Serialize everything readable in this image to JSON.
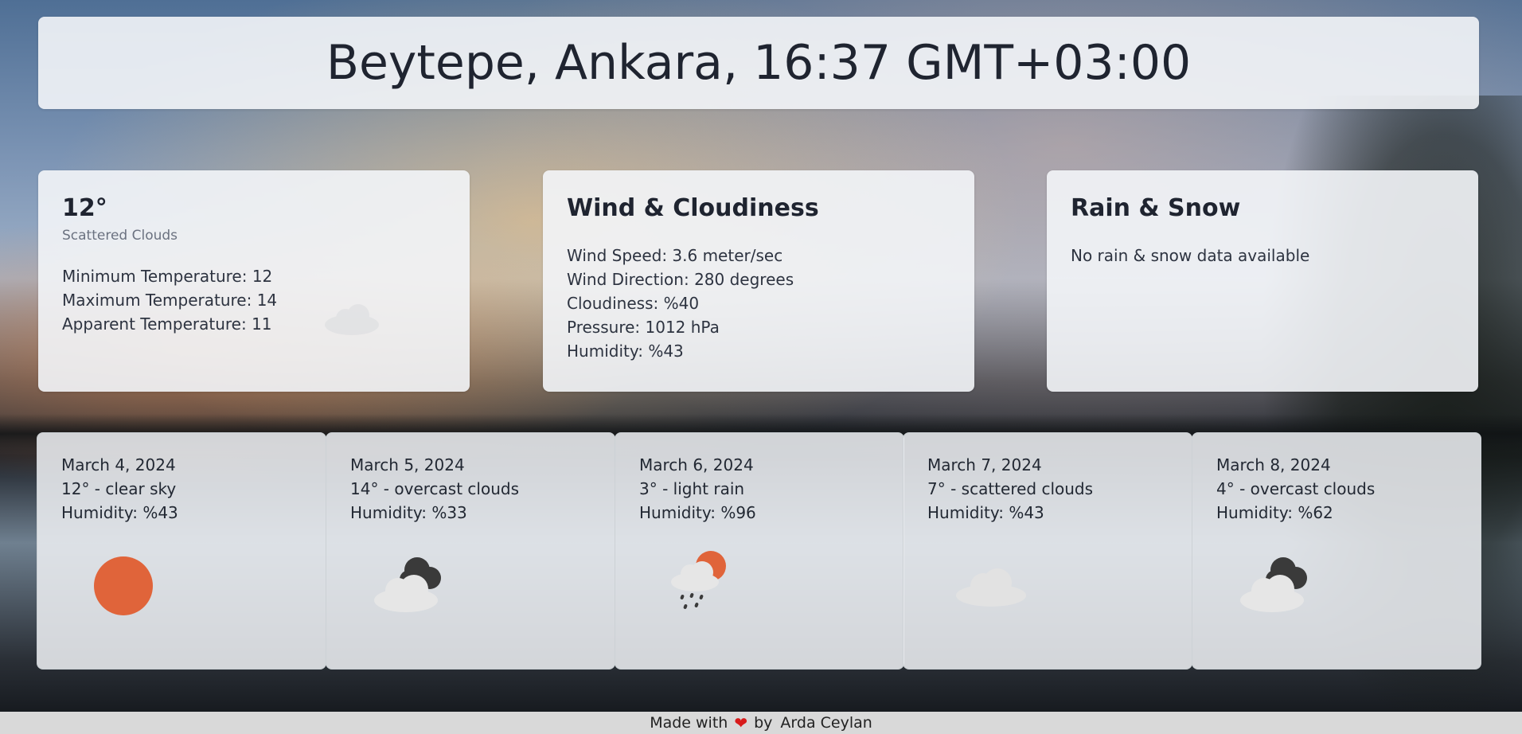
{
  "header": {
    "location_time": "Beytepe, Ankara, 16:37 GMT+03:00"
  },
  "current": {
    "temperature": "12°",
    "description": "Scattered Clouds",
    "lines": [
      "Minimum Temperature: 12",
      "Maximum Temperature: 14",
      "Apparent Temperature: 11"
    ],
    "icon": "scattered-clouds-icon"
  },
  "wind": {
    "title": "Wind & Cloudiness",
    "lines": [
      "Wind Speed: 3.6 meter/sec",
      "Wind Direction: 280 degrees",
      "Cloudiness: %40",
      "Pressure: 1012 hPa",
      "Humidity: %43"
    ]
  },
  "rain": {
    "title": "Rain & Snow",
    "message": "No rain & snow data available"
  },
  "forecast": [
    {
      "date": "March 4, 2024",
      "summary": "12° - clear sky",
      "humidity": "Humidity: %43",
      "icon": "sun-icon"
    },
    {
      "date": "March 5, 2024",
      "summary": "14° - overcast clouds",
      "humidity": "Humidity: %33",
      "icon": "overcast-clouds-icon"
    },
    {
      "date": "March 6, 2024",
      "summary": "3° - light rain",
      "humidity": "Humidity: %96",
      "icon": "light-rain-icon"
    },
    {
      "date": "March 7, 2024",
      "summary": "7° - scattered clouds",
      "humidity": "Humidity: %43",
      "icon": "cloud-icon"
    },
    {
      "date": "March 8, 2024",
      "summary": "4° - overcast clouds",
      "humidity": "Humidity: %62",
      "icon": "overcast-clouds-icon"
    }
  ],
  "footer": {
    "made_with": "Made with",
    "heart": "❤",
    "by": "by",
    "author": "Arda Ceylan"
  },
  "colors": {
    "sun": "#e0643a",
    "dark_cloud": "#3a3a3a",
    "light_cloud": "#e6e6e6",
    "heart": "#d81b1b"
  }
}
